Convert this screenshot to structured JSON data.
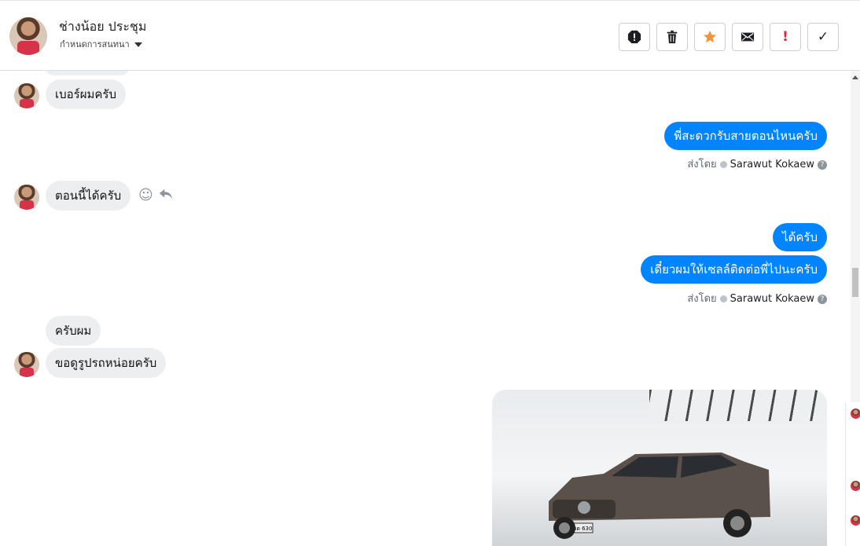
{
  "header": {
    "contact_name": "ช่างน้อย ประชุม",
    "subtitle": "กำหนดการสนทนา",
    "actions": [
      {
        "name": "spam-icon",
        "label": "!"
      },
      {
        "name": "trash-icon",
        "label": ""
      },
      {
        "name": "star-icon",
        "label": ""
      },
      {
        "name": "mail-icon",
        "label": ""
      },
      {
        "name": "important-icon",
        "label": "!"
      },
      {
        "name": "check-icon",
        "label": "✓"
      }
    ]
  },
  "messages": [
    {
      "dir": "in",
      "text": "เบอร์ผมครับ"
    },
    {
      "dir": "out",
      "text": "พี่สะดวกรับสายตอนไหนครับ"
    },
    {
      "dir": "in",
      "text": "ตอนนี้ได้ครับ"
    },
    {
      "dir": "out",
      "text": "ได้ครับ"
    },
    {
      "dir": "out",
      "text": "เดี๋ยวผมให้เซลล์ติดต่อพี่ไปนะครับ"
    },
    {
      "dir": "in",
      "text": "ครับผม"
    },
    {
      "dir": "in",
      "text": "ขอดูรูปรถหน่อยครับ"
    }
  ],
  "sent_by": {
    "prefix": "ส่งโดย",
    "agent": "Sarawut Kokaew",
    "help": "?"
  },
  "photo_plate": "ขต 630",
  "colors": {
    "outgoing": "#0084ff",
    "incoming": "#eceef0",
    "star": "#f7923a",
    "alert": "#e41e3f"
  }
}
